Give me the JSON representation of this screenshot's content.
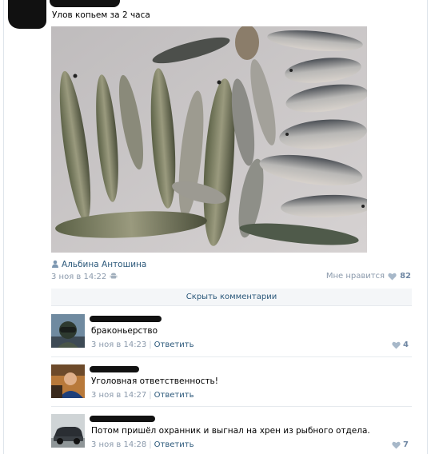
{
  "post": {
    "text": "Улов копьем за 2 часа",
    "signed_by": "Альбина Антошина",
    "date": "3 ноя в 14:22",
    "likes_label": "Мне нравится",
    "likes_count": "82"
  },
  "comments_toggle": "Скрыть комментарии",
  "comments": [
    {
      "text": "браконьерство",
      "date": "3 ноя в 14:23",
      "reply": "Ответить",
      "likes": "4"
    },
    {
      "text": "Уголовная ответственность!",
      "date": "3 ноя в 14:27",
      "reply": "Ответить",
      "likes": ""
    },
    {
      "text": "Потом пришёл охранник и выгнал на хрен из рыбного отдела.",
      "date": "3 ноя в 14:28",
      "reply": "Ответить",
      "likes": "7"
    }
  ],
  "colors": {
    "link": "#2b587a",
    "meta": "#8a99ab",
    "like": "#6f87a3"
  },
  "icons": [
    "person-icon",
    "android-icon",
    "heart-icon"
  ]
}
